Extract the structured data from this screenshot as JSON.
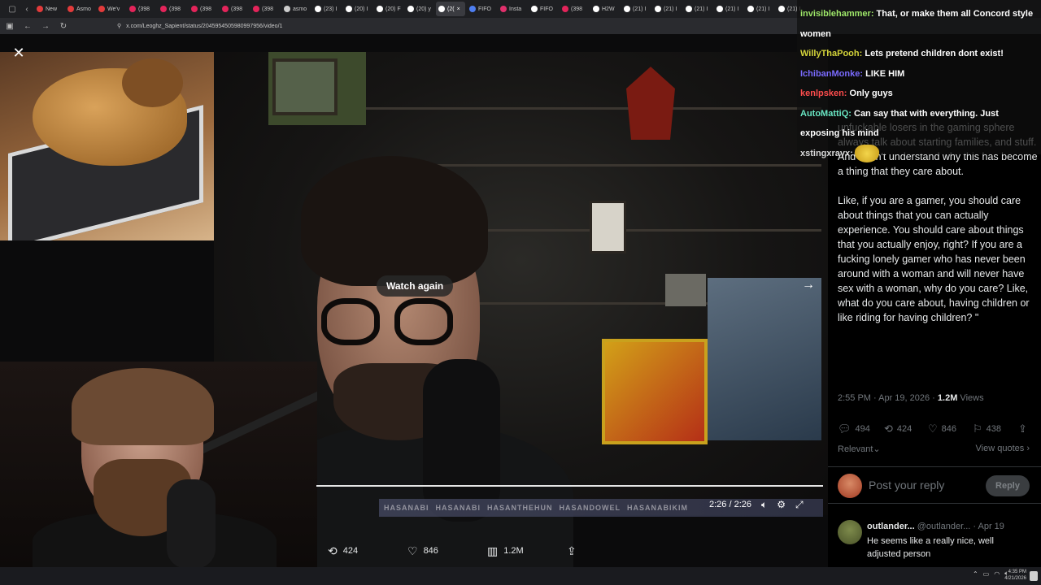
{
  "browser": {
    "tabs": [
      {
        "label": "New",
        "color": "#e33b3b",
        "active": false
      },
      {
        "label": "Asmo",
        "color": "#e33b3b",
        "active": false
      },
      {
        "label": "We'v",
        "color": "#e33b3b",
        "active": false
      },
      {
        "label": "(398",
        "color": "#e3245a",
        "active": false
      },
      {
        "label": "(398",
        "color": "#e3245a",
        "active": false
      },
      {
        "label": "(398",
        "color": "#e3245a",
        "active": false
      },
      {
        "label": "(398",
        "color": "#e3245a",
        "active": false
      },
      {
        "label": "(398",
        "color": "#e3245a",
        "active": false
      },
      {
        "label": "asmo",
        "color": "#cccccc",
        "active": false
      },
      {
        "label": "(23) I",
        "color": "#ffffff",
        "active": false
      },
      {
        "label": "(20) I",
        "color": "#ffffff",
        "active": false
      },
      {
        "label": "(20) F",
        "color": "#ffffff",
        "active": false
      },
      {
        "label": "(20) y",
        "color": "#ffffff",
        "active": false
      },
      {
        "label": "(2(",
        "color": "#ffffff",
        "active": true
      },
      {
        "label": "FIFO",
        "color": "#4e7ef0",
        "active": false
      },
      {
        "label": "Insta",
        "color": "#e1306c",
        "active": false
      },
      {
        "label": "FIFO",
        "color": "#ffffff",
        "active": false
      },
      {
        "label": "(398",
        "color": "#e3245a",
        "active": false
      },
      {
        "label": "H2W",
        "color": "#ffffff",
        "active": false
      },
      {
        "label": "(21) I",
        "color": "#ffffff",
        "active": false
      },
      {
        "label": "(21) I",
        "color": "#ffffff",
        "active": false
      },
      {
        "label": "(21) I",
        "color": "#ffffff",
        "active": false
      },
      {
        "label": "(21) I",
        "color": "#ffffff",
        "active": false
      },
      {
        "label": "(21) I",
        "color": "#ffffff",
        "active": false
      },
      {
        "label": "(21) I",
        "color": "#ffffff",
        "active": false
      }
    ],
    "url": "x.com/Leoghz_Sapient/status/2045954505980997956/video/1"
  },
  "video": {
    "watch_again": "Watch again",
    "time": "2:26 / 2:26",
    "progress": 1.0,
    "ticker": [
      "HASANABI",
      "HASANABI",
      "HASANTHEHUN",
      "HASANDOWEL",
      "HASANABIKIM"
    ]
  },
  "stats": {
    "reposts": "424",
    "likes": "846",
    "views": "1.2M"
  },
  "tweet": {
    "body": "unfuckable losers in the gaming sphere always talk about starting families, and stuff. And I don't understand why this has become a thing that they care about.\n\nLike, if you are a gamer, you should care about things that you can actually experience. You should care about things that you actually enjoy, right? If you are a fucking lonely gamer who has never been around with a woman and will never have sex with a woman, why do you care? Like, what do you care about, having children or like riding for having children? \"",
    "time": "2:55 PM · Apr 19, 2026 · ",
    "views_count": "1.2M",
    "views_label": " Views",
    "replies": "494",
    "reposts": "424",
    "likes": "846",
    "bookmarks": "438",
    "relevant": "Relevant",
    "view_quotes": "View quotes",
    "reply_placeholder": "Post your reply",
    "reply_button": "Reply"
  },
  "comment": {
    "name": "outlander...",
    "handle": " @outlander... · Apr 19",
    "text": "He seems like a really nice, well adjusted person"
  },
  "chat": [
    {
      "user": "invisiblehammer:",
      "color": "#9fe86a",
      "msg": " That, or make them all Concord style women"
    },
    {
      "user": "WillyThaPooh:",
      "color": "#d4d43a",
      "msg": " Lets pretend children dont exist!"
    },
    {
      "user": "IchibanMonke:",
      "color": "#7a6bff",
      "msg": " LIKE HIM"
    },
    {
      "user": "kenlpsken:",
      "color": "#ff4d4d",
      "msg": " Only guys"
    },
    {
      "user": "AutoMattiQ:",
      "color": "#69e6c3",
      "msg": " Can say that with everything. Just exposing his mind"
    },
    {
      "user": "xstingxrayx:",
      "color": "#d9d9d9",
      "msg": ""
    }
  ],
  "taskbar": {
    "time": "4:35 PM",
    "date": "4/21/2026"
  }
}
